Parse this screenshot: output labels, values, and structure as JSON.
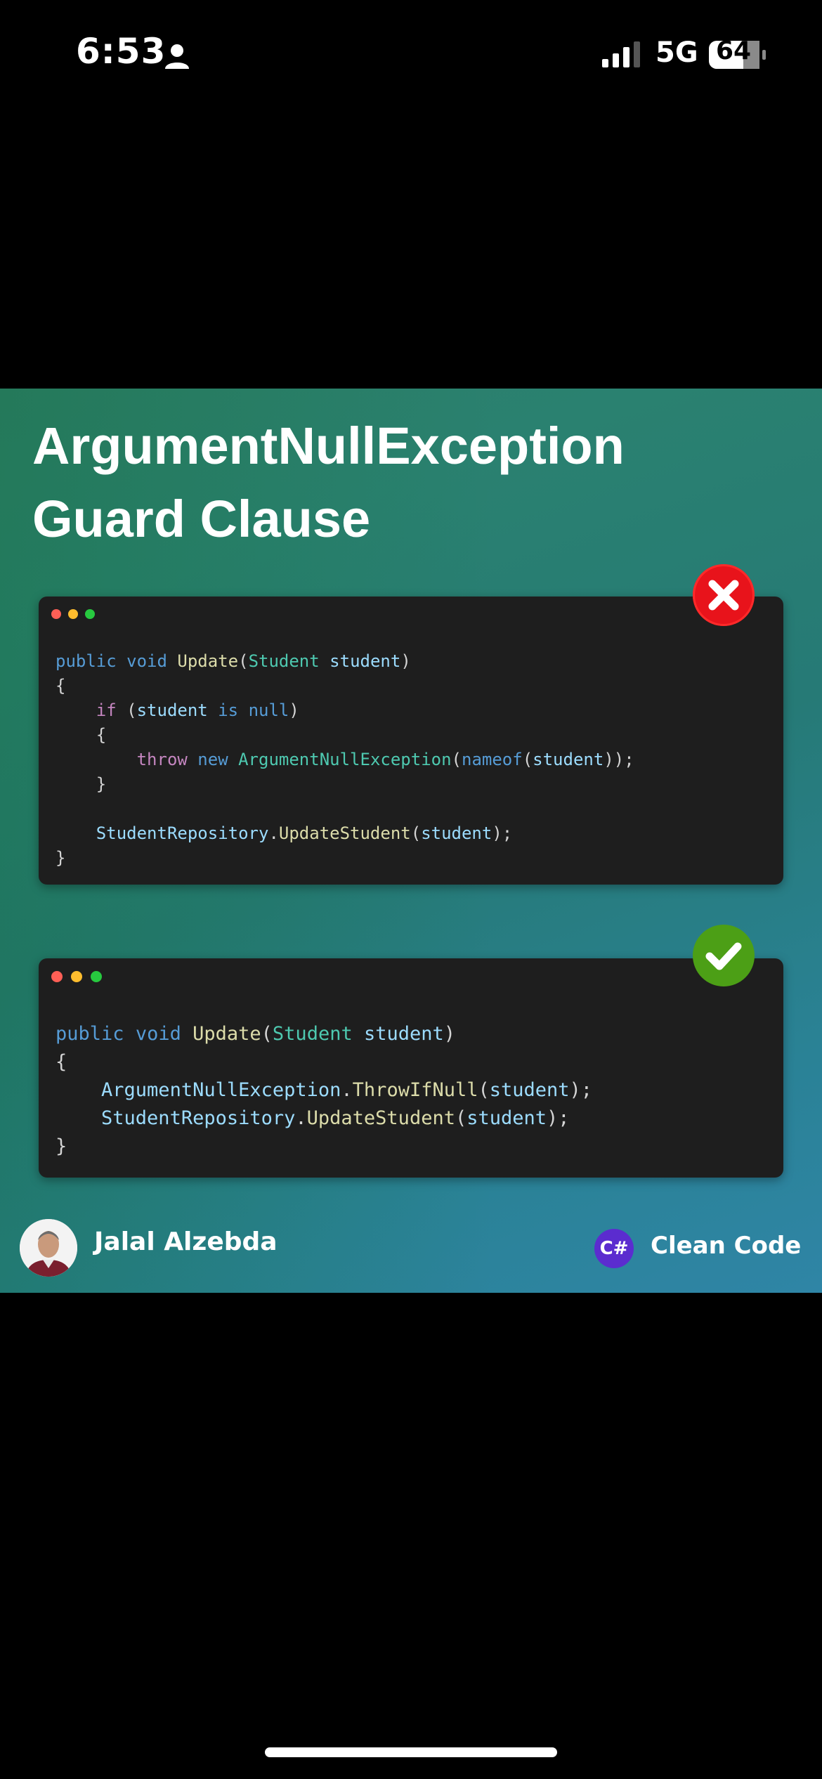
{
  "status_bar": {
    "time": "6:53",
    "network": "5G",
    "battery": "64",
    "icons": [
      "person-icon",
      "signal-icon",
      "battery-icon"
    ]
  },
  "post": {
    "title_line1": "ArgumentNullException",
    "title_line2": "Guard Clause",
    "bad_example": {
      "badge_icon": "x-icon",
      "badge_color": "#e8131b",
      "lines": [
        [
          [
            "kw",
            "public"
          ],
          [
            "pun",
            " "
          ],
          [
            "kw",
            "void"
          ],
          [
            "pun",
            " "
          ],
          [
            "fn",
            "Update"
          ],
          [
            "pun",
            "("
          ],
          [
            "ty",
            "Student"
          ],
          [
            "pun",
            " "
          ],
          [
            "var",
            "student"
          ],
          [
            "pun",
            ")"
          ]
        ],
        [
          [
            "pun",
            "{"
          ]
        ],
        [
          [
            "pun",
            "    "
          ],
          [
            "ctl",
            "if"
          ],
          [
            "pun",
            " ("
          ],
          [
            "var",
            "student"
          ],
          [
            "pun",
            " "
          ],
          [
            "kw",
            "is"
          ],
          [
            "pun",
            " "
          ],
          [
            "kw",
            "null"
          ],
          [
            "pun",
            ")"
          ]
        ],
        [
          [
            "pun",
            "    {"
          ]
        ],
        [
          [
            "pun",
            "        "
          ],
          [
            "ctl",
            "throw"
          ],
          [
            "pun",
            " "
          ],
          [
            "kw",
            "new"
          ],
          [
            "pun",
            " "
          ],
          [
            "ty",
            "ArgumentNullException"
          ],
          [
            "pun",
            "("
          ],
          [
            "kw",
            "nameof"
          ],
          [
            "pun",
            "("
          ],
          [
            "var",
            "student"
          ],
          [
            "pun",
            "));"
          ]
        ],
        [
          [
            "pun",
            "    }"
          ]
        ],
        [
          [
            "pun",
            ""
          ]
        ],
        [
          [
            "pun",
            "    "
          ],
          [
            "var",
            "StudentRepository"
          ],
          [
            "pun",
            "."
          ],
          [
            "fn",
            "UpdateStudent"
          ],
          [
            "pun",
            "("
          ],
          [
            "var",
            "student"
          ],
          [
            "pun",
            ");"
          ]
        ],
        [
          [
            "pun",
            "}"
          ]
        ]
      ]
    },
    "good_example": {
      "badge_icon": "check-icon",
      "badge_color": "#4c9f16",
      "lines": [
        [
          [
            "kw",
            "public"
          ],
          [
            "pun",
            " "
          ],
          [
            "kw",
            "void"
          ],
          [
            "pun",
            " "
          ],
          [
            "fn",
            "Update"
          ],
          [
            "pun",
            "("
          ],
          [
            "ty",
            "Student"
          ],
          [
            "pun",
            " "
          ],
          [
            "var",
            "student"
          ],
          [
            "pun",
            ")"
          ]
        ],
        [
          [
            "pun",
            "{"
          ]
        ],
        [
          [
            "pun",
            "    "
          ],
          [
            "var",
            "ArgumentNullException"
          ],
          [
            "pun",
            "."
          ],
          [
            "fn",
            "ThrowIfNull"
          ],
          [
            "pun",
            "("
          ],
          [
            "var",
            "student"
          ],
          [
            "pun",
            ");"
          ]
        ],
        [
          [
            "pun",
            "    "
          ],
          [
            "var",
            "StudentRepository"
          ],
          [
            "pun",
            "."
          ],
          [
            "fn",
            "UpdateStudent"
          ],
          [
            "pun",
            "("
          ],
          [
            "var",
            "student"
          ],
          [
            "pun",
            ");"
          ]
        ],
        [
          [
            "pun",
            "}"
          ]
        ]
      ]
    },
    "author": "Jalal Alzebda",
    "logo_text": "C#",
    "tag": "Clean Code"
  }
}
